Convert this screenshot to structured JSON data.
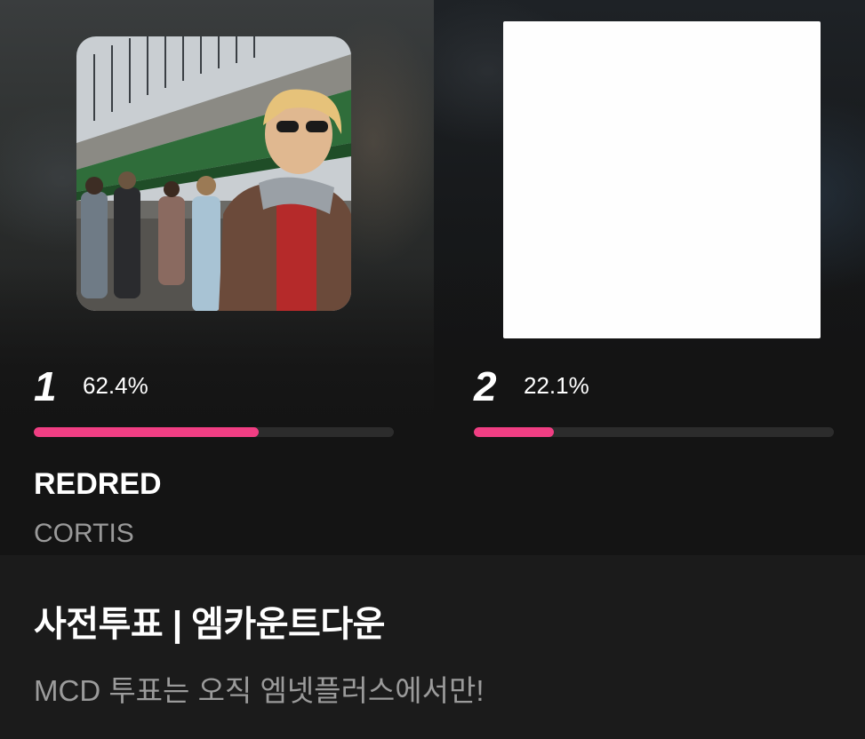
{
  "colors": {
    "accent": "#f03e83",
    "background": "#141414",
    "section_background": "#1b1b1b",
    "track": "#2c2c2c",
    "secondary_text": "#9a9a9a"
  },
  "rankings": [
    {
      "rank": "1",
      "percent_label": "62.4%",
      "percent_value": 62.4,
      "title": "REDRED",
      "artist": "CORTIS",
      "album_art": "group-photo-under-bridge"
    },
    {
      "rank": "2",
      "percent_label": "22.1%",
      "percent_value": 22.1,
      "album_art": "blank-white"
    }
  ],
  "info": {
    "title": "사전투표 | 엠카운트다운",
    "subtitle": "MCD 투표는 오직 엠넷플러스에서만!"
  }
}
